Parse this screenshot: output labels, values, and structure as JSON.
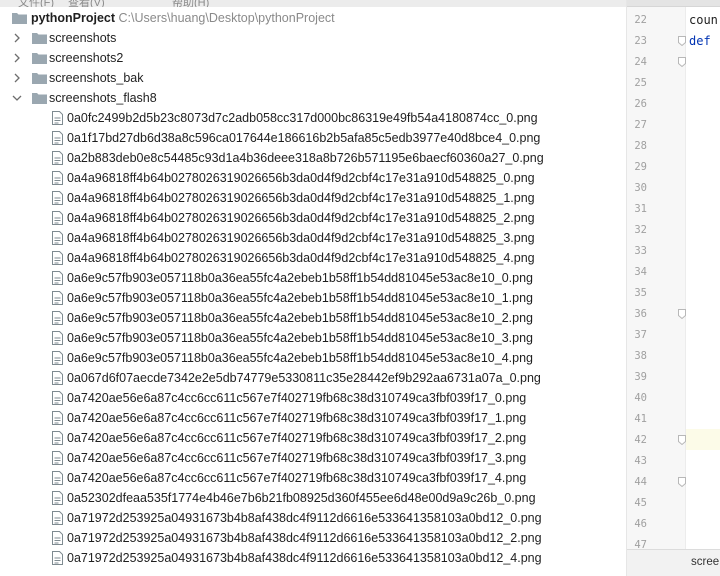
{
  "menu": {
    "items": [
      "文件(F)",
      "查看(V)",
      "帮助(H)"
    ]
  },
  "project": {
    "name": "pythonProject",
    "path": "C:\\Users\\huang\\Desktop\\pythonProject",
    "folders": [
      {
        "label": "screenshots",
        "expanded": false
      },
      {
        "label": "screenshots2",
        "expanded": false
      },
      {
        "label": "screenshots_bak",
        "expanded": false
      },
      {
        "label": "screenshots_flash8",
        "expanded": true
      }
    ],
    "files": [
      "0a0fc2499b2d5b23c8073d7c2adb058cc317d000bc86319e49fb54a4180874cc_0.png",
      "0a1f17bd27db6d38a8c596ca017644e186616b2b5afa85c5edb3977e40d8bce4_0.png",
      "0a2b883deb0e8c54485c93d1a4b36deee318a8b726b571195e6baecf60360a27_0.png",
      "0a4a96818ff4b64b0278026319026656b3da0d4f9d2cbf4c17e31a910d548825_0.png",
      "0a4a96818ff4b64b0278026319026656b3da0d4f9d2cbf4c17e31a910d548825_1.png",
      "0a4a96818ff4b64b0278026319026656b3da0d4f9d2cbf4c17e31a910d548825_2.png",
      "0a4a96818ff4b64b0278026319026656b3da0d4f9d2cbf4c17e31a910d548825_3.png",
      "0a4a96818ff4b64b0278026319026656b3da0d4f9d2cbf4c17e31a910d548825_4.png",
      "0a6e9c57fb903e057118b0a36ea55fc4a2ebeb1b58ff1b54dd81045e53ac8e10_0.png",
      "0a6e9c57fb903e057118b0a36ea55fc4a2ebeb1b58ff1b54dd81045e53ac8e10_1.png",
      "0a6e9c57fb903e057118b0a36ea55fc4a2ebeb1b58ff1b54dd81045e53ac8e10_2.png",
      "0a6e9c57fb903e057118b0a36ea55fc4a2ebeb1b58ff1b54dd81045e53ac8e10_3.png",
      "0a6e9c57fb903e057118b0a36ea55fc4a2ebeb1b58ff1b54dd81045e53ac8e10_4.png",
      "0a067d6f07aecde7342e2e5db74779e5330811c35e28442ef9b292aa6731a07a_0.png",
      "0a7420ae56e6a87c4cc6cc611c567e7f402719fb68c38d310749ca3fbf039f17_0.png",
      "0a7420ae56e6a87c4cc6cc611c567e7f402719fb68c38d310749ca3fbf039f17_1.png",
      "0a7420ae56e6a87c4cc6cc611c567e7f402719fb68c38d310749ca3fbf039f17_2.png",
      "0a7420ae56e6a87c4cc6cc611c567e7f402719fb68c38d310749ca3fbf039f17_3.png",
      "0a7420ae56e6a87c4cc6cc611c567e7f402719fb68c38d310749ca3fbf039f17_4.png",
      "0a52302dfeaa535f1774e4b46e7b6b21fb08925d360f455ee6d48e00d9a9c26b_0.png",
      "0a71972d253925a04931673b4b8af438dc4f9112d6616e533641358103a0bd12_0.png",
      "0a71972d253925a04931673b4b8af438dc4f9112d6616e533641358103a0bd12_2.png",
      "0a71972d253925a04931673b4b8af438dc4f9112d6616e533641358103a0bd12_4.png"
    ]
  },
  "editor": {
    "line_numbers": [
      "22",
      "23",
      "24",
      "25",
      "26",
      "27",
      "28",
      "29",
      "30",
      "31",
      "32",
      "33",
      "34",
      "35",
      "36",
      "37",
      "38",
      "39",
      "40",
      "41",
      "42",
      "43",
      "44",
      "45",
      "46",
      "47"
    ],
    "code_lines": [
      {
        "line": "22",
        "text": "coun",
        "keyword": false
      },
      {
        "line": "23",
        "text": "def",
        "keyword": true
      }
    ],
    "fold_lines": [
      "23",
      "24",
      "36",
      "42",
      "44"
    ],
    "current_line": "42",
    "bottom_tab": "scree"
  },
  "colors": {
    "folder": "#9aa7b0",
    "file": "#7f8b91",
    "keyword": "#0033b3",
    "path": "#8a8a8a"
  }
}
